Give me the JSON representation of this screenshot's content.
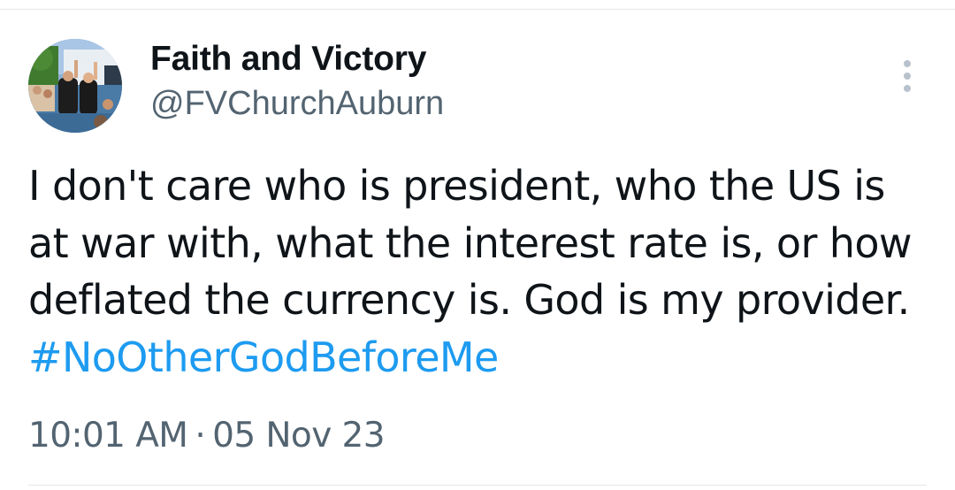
{
  "account": {
    "display_name": "Faith and Victory",
    "handle": "@FVChurchAuburn",
    "avatar_icon": "profile-photo"
  },
  "actions": {
    "more_icon": "more-vertical-icon"
  },
  "tweet": {
    "lines": [
      "I don't care who is president, who the US is",
      "at war with, what the interest rate is, or how",
      "deflated the currency is.  God is my provider."
    ],
    "hashtag": "#NoOtherGodBeforeMe"
  },
  "meta": {
    "time": "10:01 AM",
    "separator": "·",
    "date": "05 Nov 23"
  },
  "colors": {
    "text": "#0f1419",
    "secondary": "#536471",
    "link": "#1d9bf0",
    "divider": "#e7e7e7"
  }
}
